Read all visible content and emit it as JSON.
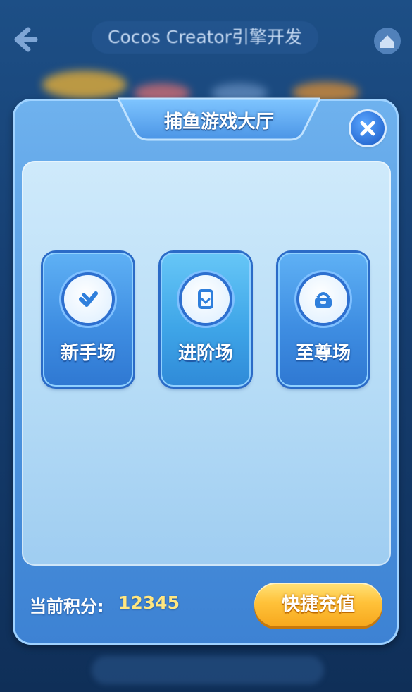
{
  "header": {
    "title": "Cocos Creator引擎开发"
  },
  "dialog": {
    "title": "捕鱼游戏大厅",
    "rooms": [
      {
        "label": "新手场",
        "icon": "checkmark-badge-icon"
      },
      {
        "label": "进阶场",
        "icon": "document-badge-icon"
      },
      {
        "label": "至尊场",
        "icon": "treasure-basket-icon"
      }
    ],
    "score_label": "当前积分:",
    "score_value": "12345",
    "recharge_label": "快捷充值"
  },
  "colors": {
    "panel_blue": "#4f96e0",
    "score_yellow": "#ffe680",
    "recharge_orange": "#ffc23a"
  }
}
